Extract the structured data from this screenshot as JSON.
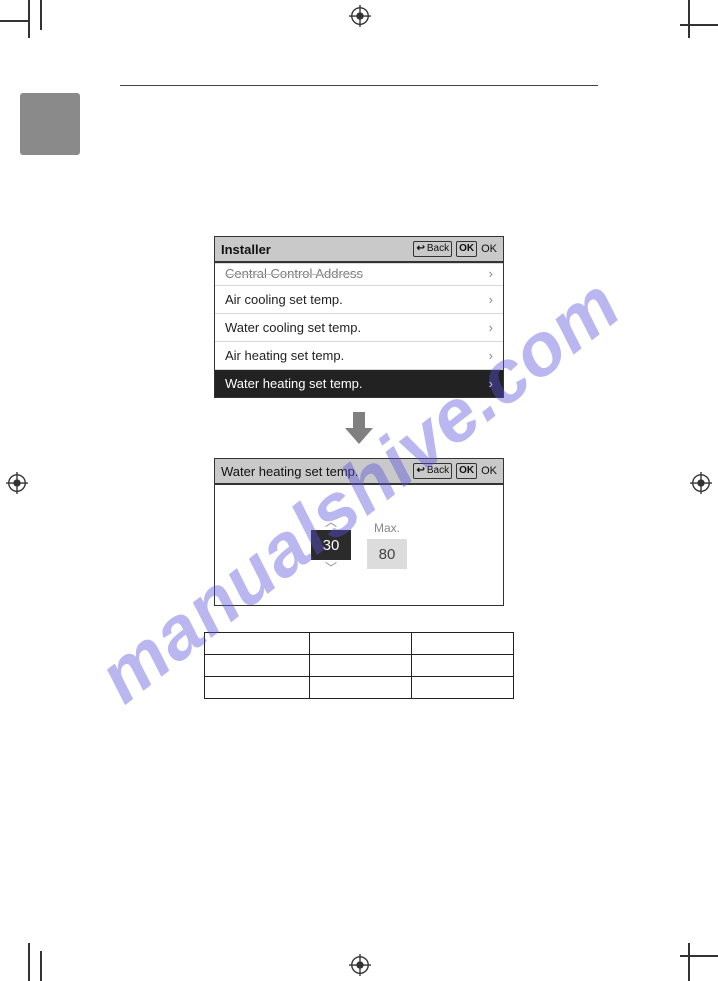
{
  "watermark": "manualshive.com",
  "panel1": {
    "title": "Installer",
    "back_label": "Back",
    "ok_label": "OK",
    "rows": {
      "r0": "Central Control Address",
      "r1": "Air cooling set temp.",
      "r2": "Water cooling set temp.",
      "r3": "Air heating set temp.",
      "r4": "Water heating set temp."
    }
  },
  "panel2": {
    "title": "Water heating set temp.",
    "back_label": "Back",
    "ok_label": "OK",
    "value": "30",
    "max_label": "Max.",
    "max_value": "80"
  },
  "chart_data": {
    "type": "table",
    "rows": 3,
    "cols": 3,
    "cells": [
      [
        "",
        "",
        ""
      ],
      [
        "",
        "",
        ""
      ],
      [
        "",
        "",
        ""
      ]
    ]
  }
}
